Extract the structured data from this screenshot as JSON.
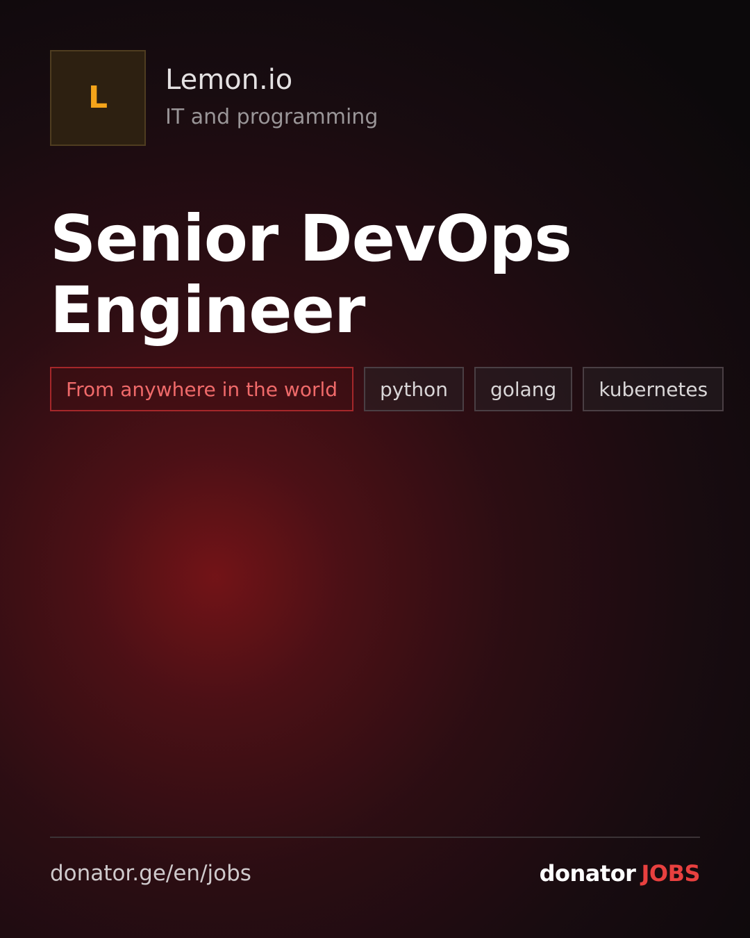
{
  "company": {
    "logo_letter": "L",
    "name": "Lemon.io",
    "category": "IT and programming"
  },
  "job": {
    "title": "Senior DevOps Engineer"
  },
  "tags": [
    {
      "label": "From anywhere in the world",
      "kind": "location"
    },
    {
      "label": "python",
      "kind": "skill"
    },
    {
      "label": "golang",
      "kind": "skill"
    },
    {
      "label": "kubernetes",
      "kind": "skill"
    }
  ],
  "footer": {
    "url": "donator.ge/en/jobs",
    "brand_name": "donator",
    "brand_suffix": "JOBS"
  },
  "colors": {
    "accent_red": "#e8403f",
    "logo_orange": "#f4a41a",
    "background": "#0c090b"
  }
}
